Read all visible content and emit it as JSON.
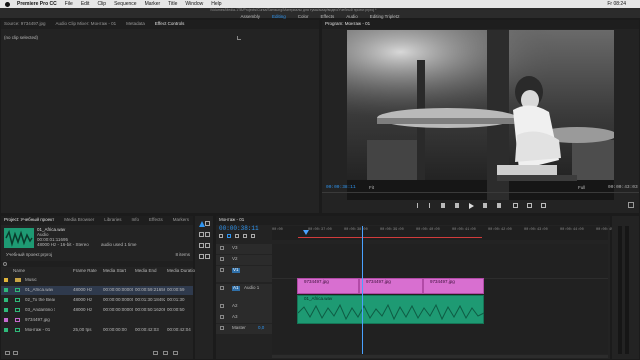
{
  "menubar": {
    "app": "Premiere Pro CC",
    "items": [
      "File",
      "Edit",
      "Clip",
      "Sequence",
      "Marker",
      "Title",
      "Window",
      "Help"
    ],
    "window_title": "/Volumes/Media-1TB/Projects/Cursa/Samsung/Материалы для тумы/мазу/видео/Учебный проект.prproj *",
    "clock": "Fr 08:24"
  },
  "workspaces": [
    "Assembly",
    "Editing",
    "Color",
    "Effects",
    "Audio",
    "Editing Triplet2"
  ],
  "workspace_active": "Editing",
  "source_panel": {
    "tabs": [
      "Source: 9734497.jpg",
      "Audio Clip Mixer: Монтаж - 01",
      "Metadata",
      "Effect Controls"
    ],
    "active_tab": "Effect Controls",
    "message": "(no clip selected)"
  },
  "program": {
    "title": "Program: Монтаж - 01",
    "timecode_left": "00:00:38:11",
    "fit": "Fit",
    "quality": "Full",
    "timecode_right": "00:00:43:03"
  },
  "project": {
    "tabs": [
      "Project: Учебный проект",
      "Media Browser",
      "Libraries",
      "Info",
      "Effects",
      "Markers"
    ],
    "active_tab": "Project: Учебный проект",
    "selected": {
      "name": "01_Africa.wav",
      "type": "Audio",
      "duration": "00:00:01:11695",
      "format": "48000 Hz - 16-bit - Stereo",
      "usage": "audio used 1 time"
    },
    "path": "Учебный проект.prproj",
    "count": "8 items",
    "columns": [
      "Name",
      "Frame Rate",
      "Media Start",
      "Media End",
      "Media Duration"
    ],
    "rows": [
      {
        "name": "Music",
        "rate": "",
        "start": "",
        "end": "",
        "dur": "",
        "color": "#e0b43a",
        "folder": true
      },
      {
        "name": "01_Africa.wav",
        "rate": "48000 Hz",
        "start": "00:00:00:00000",
        "end": "00:00:59:21656",
        "dur": "00:00:59",
        "color": "#2fba7a",
        "folder": false
      },
      {
        "name": "02_To the Beach.wav",
        "rate": "48000 Hz",
        "start": "00:00:00:00000",
        "end": "00:01:30:18492",
        "dur": "00:01:30",
        "color": "#2fba7a",
        "folder": false
      },
      {
        "name": "03_Andantino Show.wav",
        "rate": "48000 Hz",
        "start": "00:00:00:00000",
        "end": "00:00:50:16208",
        "dur": "00:00:50",
        "color": "#2fba7a",
        "folder": false
      },
      {
        "name": "9734497.jpg",
        "rate": "",
        "start": "",
        "end": "",
        "dur": "",
        "color": "#c66ad0",
        "folder": false
      },
      {
        "name": "Монтаж - 01",
        "rate": "25,00 fps",
        "start": "00:00:00:00",
        "end": "00:00:42:03",
        "dur": "00:00:42:04",
        "color": "#2fba7a",
        "folder": false
      }
    ]
  },
  "timeline": {
    "tab": "Монтаж - 01",
    "timecode": "00:00:38:11",
    "ruler": [
      "00:00",
      "00:00:37:00",
      "00:00:38:00",
      "00:00:39:00",
      "00:00:40:00",
      "00:00:41:00",
      "00:00:42:00",
      "00:00:43:00",
      "00:00:44:00",
      "00:00:45:00"
    ],
    "tracks": [
      "V3",
      "V2",
      "V1",
      "A1",
      "A2",
      "A3",
      "Master"
    ],
    "master_value": "0,0",
    "video_clips": [
      "9734497.jpg",
      "9734497.jpg",
      "9734497.jpg"
    ],
    "audio_clip": "01_Africa.wav",
    "track_label_a1": "Audio 1"
  },
  "colors": {
    "accent": "#2f95f0",
    "video_clip": "#d86fd0",
    "audio_clip": "#1e9a73",
    "playhead": "#4aa2ff"
  }
}
